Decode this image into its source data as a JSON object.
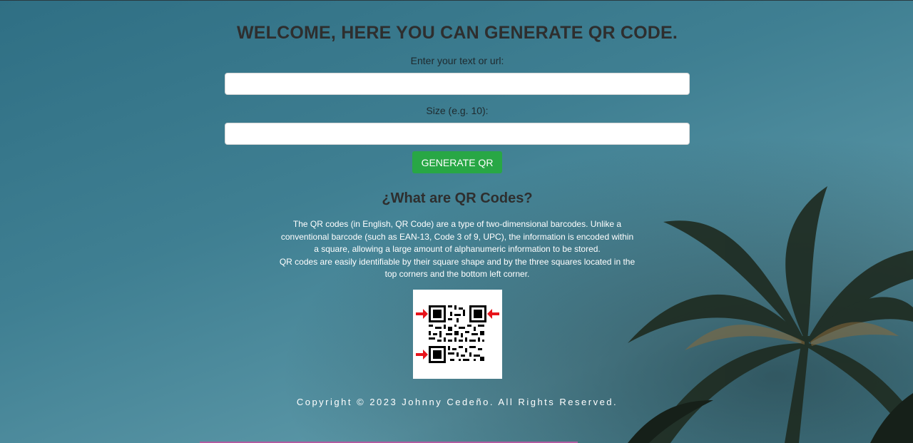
{
  "header": {
    "title": "WELCOME, HERE YOU CAN GENERATE QR CODE."
  },
  "form": {
    "text_label": "Enter your text or url:",
    "text_value": "",
    "size_label": "Size (e.g. 10):",
    "size_value": "",
    "generate_label": "GENERATE QR"
  },
  "info": {
    "heading": "¿What are QR Codes?",
    "paragraph_1": "The QR codes (in English, QR Code) are a type of two-dimensional barcodes. Unlike a conventional barcode (such as EAN-13, Code 3 of 9, UPC), the information is encoded within a square, allowing a large amount of alphanumeric information to be stored.",
    "paragraph_2": "QR codes are easily identifiable by their square shape and by the three squares located in the top corners and the bottom left corner.",
    "image_icon": "qr-code-example-icon"
  },
  "footer": {
    "copyright": "Copyright © 2023 Johnny Cedeño. All Rights Reserved."
  },
  "colors": {
    "button": "#28a745",
    "heading": "#2e2e2e",
    "arrows": "#e8141b"
  }
}
